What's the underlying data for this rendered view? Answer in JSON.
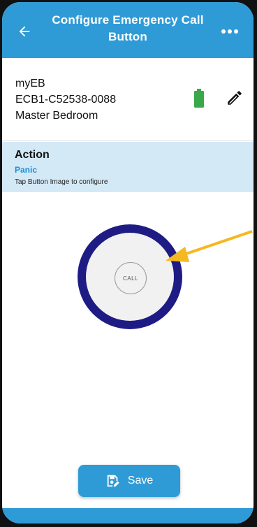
{
  "header": {
    "title": "Configure Emergency Call Button",
    "back_icon": "arrow-left-icon",
    "more_icon": "more-horizontal-icon"
  },
  "device": {
    "name": "myEB",
    "id": "ECB1-C52538-0088",
    "location": "Master Bedroom",
    "battery_icon": "battery-full-icon",
    "battery_color": "#3aa84a",
    "edit_icon": "pencil-icon"
  },
  "action": {
    "label": "Action",
    "value": "Panic",
    "hint": "Tap Button Image to configure"
  },
  "button_image": {
    "label": "CALL",
    "ring_color": "#1e1c84"
  },
  "save": {
    "label": "Save",
    "icon": "save-edit-icon"
  },
  "colors": {
    "primary": "#2f9bd6",
    "action_bg": "#d4e9f6",
    "accent_text": "#1e8fd4",
    "arrow": "#f5b820"
  }
}
